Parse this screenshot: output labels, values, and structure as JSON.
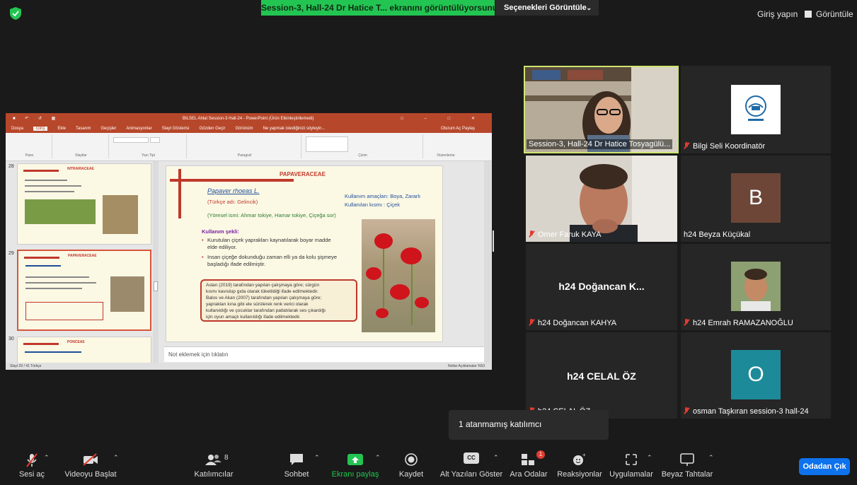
{
  "top": {
    "share_banner": "Session-3, Hall-24 Dr Hatice T... ekranını görüntülüyorsunuz",
    "view_options": "Seçenekleri Görüntüle",
    "sign_in": "Giriş yapın",
    "view": "Görüntüle"
  },
  "ppt": {
    "window_title": "BILSEL Ahlat Session-3 Hall-24 - PowerPoint (Ürün Etkinleştirilemedi)",
    "menu": [
      "Dosya",
      "Giriş",
      "Ekle",
      "Tasarım",
      "Geçişler",
      "Animasyonlar",
      "Slayt Gösterisi",
      "Gözden Geçir",
      "Görünüm",
      "Ne yapmak istediğinizi söyleyin..."
    ],
    "menu_right": "Oturum Aç   Paylaş",
    "ribbon_groups": [
      "Pano",
      "Slaytlar",
      "Yazı Tipi",
      "Paragraf",
      "Çizim",
      "Düzenleme"
    ],
    "thumb_numbers": [
      "28",
      "29",
      "30"
    ],
    "thumb_titles": [
      "NITRARIACEAE",
      "PAPAVERACEAE",
      "PONCEAE"
    ],
    "slide": {
      "title": "PAPAVERACEAE",
      "species": "Papaver rhoeas L.",
      "turkish_name": "(Türkçe adı: Gelincik)",
      "local_names": "(Yöresel ismi: Ahmar tokiye, Hamar tokiye, Çiçeğa sor)",
      "purpose": "Kullanım amaçları: Boya, Zararlı",
      "part": "Kullanılan kısmı  : Çiçek",
      "usage_heading": "Kullanım şekli:",
      "bullet1_a": "Kurutulan çiçek yaprakları kaynatılarak boyar madde",
      "bullet1_b": "elde ediliyor.",
      "bullet2_a": "Insan çiçeğe dokunduğu zaman elli ya da kolu şişmeye",
      "bullet2_b": "başladığı ifade edilmiştir.",
      "box": [
        "Aslan (2019) tarafından yapılan çalışmaya göre; sürgün",
        "kısmı kavrulup gıda olarak tüketildiği ifade edilmektedir.",
        "Balos ve Akan (2007) tarafından yapılan çalışmaya göre;",
        "yaprakları kına gibi ele sürülerek renk verici olarak",
        "kullanıldığı ve çocuklar tarafından patlatılarak ses çıkardığı",
        "için oyun amaçlı kullanıldığı ifade edilmektedir."
      ]
    },
    "notes_placeholder": "Not eklemek için tıklatın",
    "status_left": "Slayt 29 / 41    Türkçe",
    "status_right": "Notlar   Açıklamalar    %53"
  },
  "participants": [
    {
      "name": "Session-3, Hall-24 Dr Hatice Tosyagülü...",
      "muted": false
    },
    {
      "name": "Bilgi Seli Koordinatör",
      "muted": true
    },
    {
      "name": "Omer Faruk KAYA",
      "muted": true
    },
    {
      "name": "h24 Beyza Küçükal",
      "muted": false,
      "initial": "B"
    },
    {
      "name": "h24 Doğancan KAHYA",
      "muted": true,
      "center": "h24 Doğancan K..."
    },
    {
      "name": "h24 Emrah RAMAZANOĞLU",
      "muted": true
    },
    {
      "name": "h24 CELAL ÖZ",
      "muted": true,
      "center": "h24 CELAL ÖZ"
    },
    {
      "name": "osman Taşkıran session-3  hall-24",
      "muted": true,
      "initial": "O"
    }
  ],
  "tooltip": "1 atanmamış katılımcı",
  "toolbar": {
    "audio": "Sesi aç",
    "video": "Videoyu Başlat",
    "participants": "Katılımcılar",
    "participants_count": "8",
    "chat": "Sohbet",
    "share": "Ekranı paylaş",
    "record": "Kaydet",
    "captions": "Alt Yazıları Göster",
    "breakout": "Ara Odalar",
    "breakout_badge": "1",
    "reactions": "Reaksiyonlar",
    "apps": "Uygulamalar",
    "whiteboard": "Beyaz Tahtalar",
    "leave": "Odadan Çık",
    "cc": "CC"
  },
  "colors": {
    "accent_green": "#23c552",
    "leave_blue": "#0e72ed",
    "mute_red": "#e23b30",
    "ppt_red": "#b7472a"
  }
}
